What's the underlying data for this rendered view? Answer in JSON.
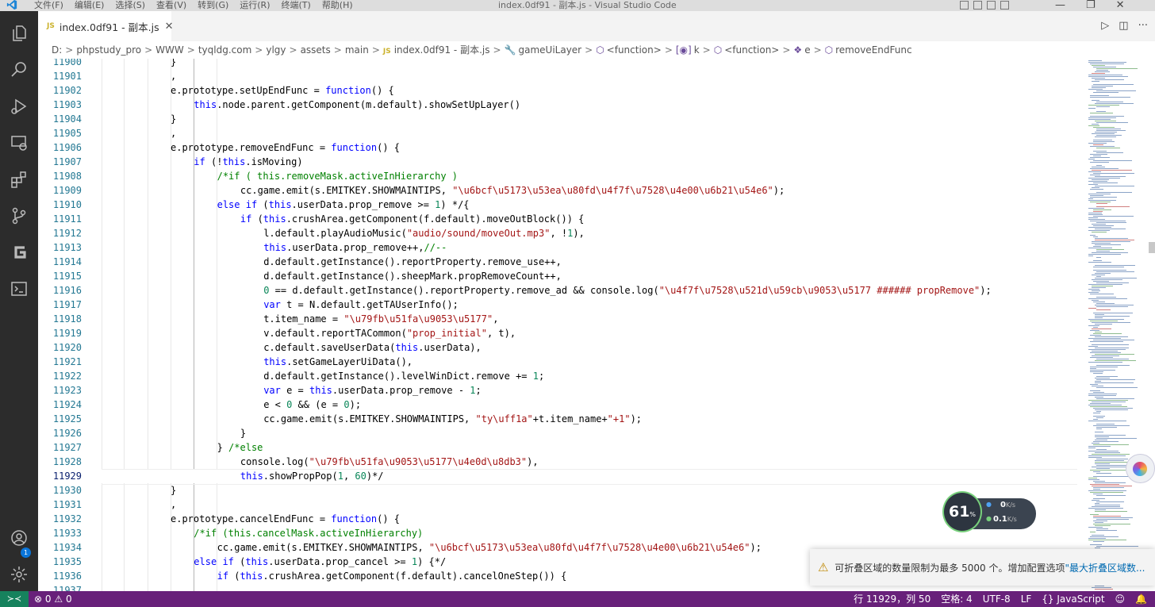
{
  "window": {
    "title": "index.0df91 - 副本.js - Visual Studio Code",
    "menus": [
      "文件(F)",
      "编辑(E)",
      "选择(S)",
      "查看(V)",
      "转到(G)",
      "运行(R)",
      "终端(T)",
      "帮助(H)"
    ],
    "controls": {
      "minimize": "—",
      "restore": "❐",
      "close": "✕"
    }
  },
  "activity": {
    "account_badge": "1"
  },
  "tab": {
    "label": "index.0df91 - 副本.js",
    "lang_tag": "JS",
    "close": "✕"
  },
  "editor_actions": {
    "run": "▷",
    "split": "◫",
    "more": "···"
  },
  "breadcrumb": [
    {
      "label": "D:",
      "kind": "folder"
    },
    {
      "label": "phpstudy_pro",
      "kind": "folder"
    },
    {
      "label": "WWW",
      "kind": "folder"
    },
    {
      "label": "tyqldg.com",
      "kind": "folder"
    },
    {
      "label": "ylgy",
      "kind": "folder"
    },
    {
      "label": "assets",
      "kind": "folder"
    },
    {
      "label": "main",
      "kind": "folder"
    },
    {
      "label": "index.0df91 - 副本.js",
      "kind": "file",
      "tag": "JS"
    },
    {
      "label": "gameUiLayer",
      "kind": "symbol",
      "icon": "🔧"
    },
    {
      "label": "<function>",
      "kind": "symbol",
      "icon": "⬡"
    },
    {
      "label": "k",
      "kind": "symbol",
      "icon": "[◉]"
    },
    {
      "label": "<function>",
      "kind": "symbol",
      "icon": "⬡"
    },
    {
      "label": "e",
      "kind": "symbol",
      "icon": "❖"
    },
    {
      "label": "removeEndFunc",
      "kind": "symbol",
      "icon": "⬡"
    }
  ],
  "code_lines": [
    {
      "n": "11900",
      "i": 2,
      "t": "}"
    },
    {
      "n": "11901",
      "i": 2,
      "t": ","
    },
    {
      "n": "11902",
      "i": 2,
      "t": "e.prototype.setUpEndFunc = function() {"
    },
    {
      "n": "11903",
      "i": 3,
      "t": "this.node.parent.getComponent(m.default).showSetUpLayer()"
    },
    {
      "n": "11904",
      "i": 2,
      "t": "}"
    },
    {
      "n": "11905",
      "i": 2,
      "t": ","
    },
    {
      "n": "11906",
      "i": 2,
      "t": "e.prototype.removeEndFunc = function() {"
    },
    {
      "n": "11907",
      "i": 3,
      "t": "if (!this.isMoving)"
    },
    {
      "n": "11908",
      "i": 4,
      "t": "/*if ( this.removeMask.activeInHierarchy )"
    },
    {
      "n": "11909",
      "i": 5,
      "t": "cc.game.emit(s.EMITKEY.SHOWMAINTIPS, \"\\u6bcf\\u5173\\u53ea\\u80fd\\u4f7f\\u7528\\u4e00\\u6b21\\u54e6\");"
    },
    {
      "n": "11910",
      "i": 4,
      "t": "else if (this.userData.prop_remove >= 1) */{"
    },
    {
      "n": "11911",
      "i": 5,
      "t": "if (this.crushArea.getComponent(f.default).moveOutBlock()) {"
    },
    {
      "n": "11912",
      "i": 6,
      "t": "l.default.playAudioMusic(\"audio/sound/moveOut.mp3\", !1),"
    },
    {
      "n": "11913",
      "i": 6,
      "t": "this.userData.prop_remove++,//--"
    },
    {
      "n": "11914",
      "i": 6,
      "t": "d.default.getInstance().reportProperty.remove_use++,"
    },
    {
      "n": "11915",
      "i": 6,
      "t": "d.default.getInstance().sheepMark.propRemoveCount++,"
    },
    {
      "n": "11916",
      "i": 6,
      "t": "0 == d.default.getInstance().reportProperty.remove_ad && console.log(\"\\u4f7f\\u7528\\u521d\\u59cb\\u9053\\u5177 ###### propRemove\");"
    },
    {
      "n": "11917",
      "i": 6,
      "t": "var t = N.default.getTAUserInfo();"
    },
    {
      "n": "11918",
      "i": 6,
      "t": "t.item_name = \"\\u79fb\\u51fa\\u9053\\u5177\","
    },
    {
      "n": "11919",
      "i": 6,
      "t": "v.default.reportTACommon(\"prop_initial\", t),"
    },
    {
      "n": "11920",
      "i": 6,
      "t": "c.default.saveUserData(this.userData),"
    },
    {
      "n": "11921",
      "i": 6,
      "t": "this.setGameLayerUiData(),"
    },
    {
      "n": "11922",
      "i": 6,
      "t": "d.default.getInstance().levelWinDict.remove += 1;"
    },
    {
      "n": "11923",
      "i": 6,
      "t": "var e = this.userData.prop_remove - 1;"
    },
    {
      "n": "11924",
      "i": 6,
      "t": "e < 0 && (e = 0);"
    },
    {
      "n": "11925",
      "i": 6,
      "t": "cc.game.emit(s.EMITKEY.SHOWMAINTIPS, \"ty\\uff1a\"+t.item_name+\"+1\");"
    },
    {
      "n": "11926",
      "i": 5,
      "t": "}"
    },
    {
      "n": "11927",
      "i": 4,
      "t": "} /*else"
    },
    {
      "n": "11928",
      "i": 5,
      "t": "console.log(\"\\u79fb\\u51fa\\u9053\\u5177\\u4e0d\\u8db3\"),"
    },
    {
      "n": "11929",
      "i": 5,
      "t": "this.showPropPop(1, 60)*/"
    },
    {
      "n": "11930",
      "i": 2,
      "t": "}"
    },
    {
      "n": "11931",
      "i": 2,
      "t": ","
    },
    {
      "n": "11932",
      "i": 2,
      "t": "e.prototype.cancelEndFunc = function() {"
    },
    {
      "n": "11933",
      "i": 3,
      "t": "/*if (this.cancelMask.activeInHierarchy)"
    },
    {
      "n": "11934",
      "i": 4,
      "t": "cc.game.emit(s.EMITKEY.SHOWMAINTIPS, \"\\u6bcf\\u5173\\u53ea\\u80fd\\u4f7f\\u7528\\u4e00\\u6b21\\u54e6\");"
    },
    {
      "n": "11935",
      "i": 3,
      "t": "else if (this.userData.prop_cancel >= 1) {*/"
    },
    {
      "n": "11936",
      "i": 4,
      "t": "if (this.crushArea.getComponent(f.default).cancelOneStep()) {"
    },
    {
      "n": "11937",
      "i": 5,
      "t": ""
    }
  ],
  "active_line": "11929",
  "net_widget": {
    "percent": "61",
    "percent_unit": "%",
    "up": "0",
    "up_unit": "K/s",
    "down": "0.1",
    "down_unit": "K/s"
  },
  "toast": {
    "message": "可折叠区域的数量限制为最多 5000 个。增加配置选项",
    "link": "\"最大折叠区域数..."
  },
  "status": {
    "remote": "≻≺",
    "errors": "0",
    "warnings": "0",
    "position": "行 11929，列 50",
    "spaces": "空格: 4",
    "encoding": "UTF-8",
    "eol": "LF",
    "language": "{} JavaScript",
    "feedback": "☺",
    "bell": "🔔"
  },
  "colors": {
    "statusbar": "#68217a",
    "remote": "#16825d",
    "activitybar": "#2c2c2c",
    "keyword": "#0000ff",
    "comment": "#008000",
    "string": "#a31515",
    "number": "#098658",
    "line_number": "#237893"
  }
}
